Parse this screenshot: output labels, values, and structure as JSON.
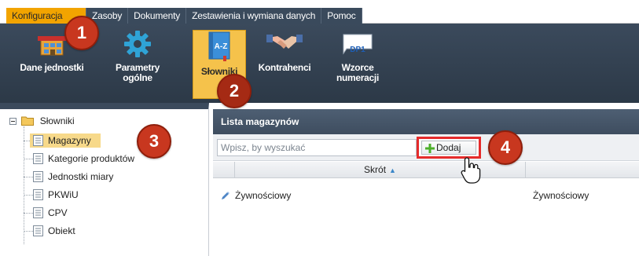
{
  "menu": {
    "tabs": [
      {
        "label": "Konfiguracja",
        "active": true
      },
      {
        "label": "Zasoby",
        "active": false
      },
      {
        "label": "Dokumenty",
        "active": false
      },
      {
        "label": "Zestawienia i wymiana danych",
        "active": false
      },
      {
        "label": "Pomoc",
        "active": false
      }
    ]
  },
  "ribbon": {
    "buttons": [
      {
        "label": "Dane jednostki",
        "icon": "building-icon"
      },
      {
        "label": "Parametry\nogólne",
        "icon": "gear-icon"
      },
      {
        "label": "Słowniki",
        "icon": "dictionary-book-icon",
        "active": true
      },
      {
        "label": "Kontrahenci",
        "icon": "handshake-icon"
      },
      {
        "label": "Wzorce\nnumeracji",
        "icon": "numbering-template-icon",
        "badge_text": "DP1"
      }
    ]
  },
  "callouts": [
    "1",
    "2",
    "3",
    "4"
  ],
  "tree": {
    "root": "Słowniki",
    "items": [
      {
        "label": "Magazyny",
        "selected": true
      },
      {
        "label": "Kategorie produktów",
        "selected": false
      },
      {
        "label": "Jednostki miary",
        "selected": false
      },
      {
        "label": "PKWiU",
        "selected": false
      },
      {
        "label": "CPV",
        "selected": false
      },
      {
        "label": "Obiekt",
        "selected": false
      }
    ]
  },
  "list": {
    "title": "Lista magazynów",
    "search_placeholder": "Wpisz, by wyszukać",
    "add_label": "Dodaj",
    "columns": [
      {
        "label": "Skrót",
        "sort": "asc"
      }
    ],
    "rows": [
      {
        "short": "Żywnościowy",
        "name": "Żywnościowy"
      }
    ]
  },
  "colors": {
    "accent": "#f2a400",
    "ribbon": "#34424f",
    "callout": "#c8371f",
    "highlight_border": "#e52b2b"
  }
}
